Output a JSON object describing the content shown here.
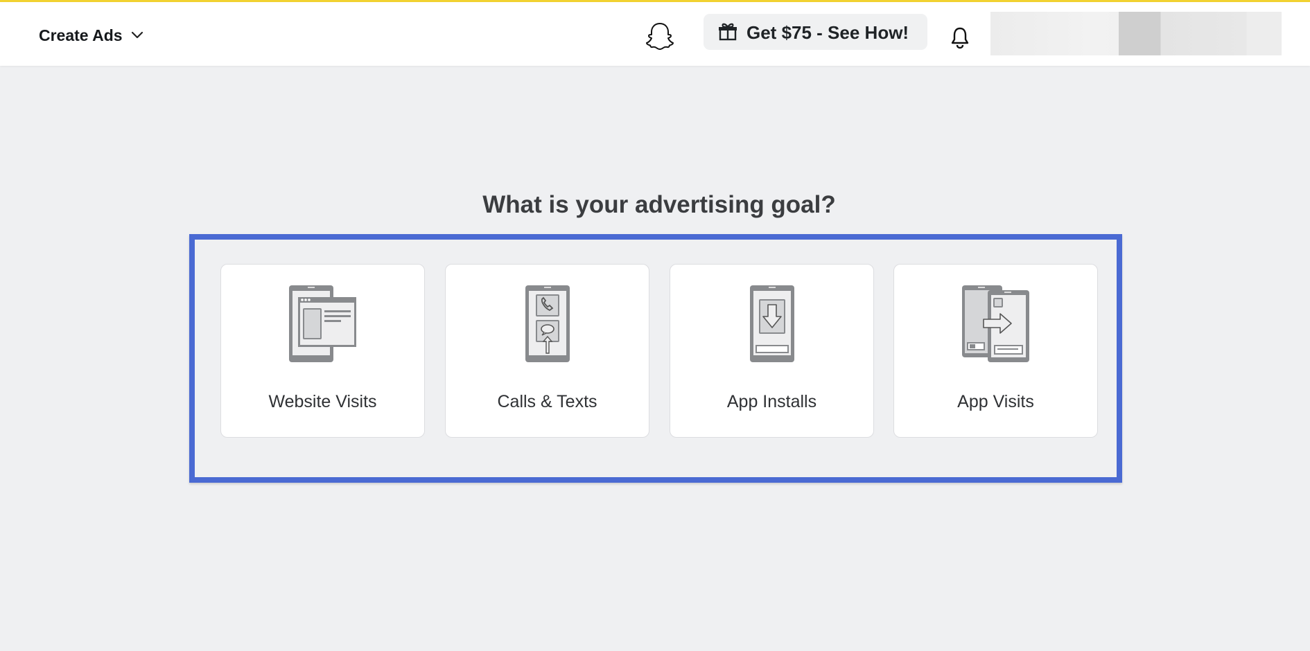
{
  "header": {
    "menu_label": "Create Ads",
    "promo_label": "Get $75 - See How!",
    "icons": [
      "chevron-down-icon",
      "snapchat-ghost-icon",
      "gift-icon",
      "bell-icon"
    ]
  },
  "main": {
    "heading": "What is your advertising goal?",
    "goals": [
      {
        "label": "Website Visits",
        "icon": "website-visits-icon"
      },
      {
        "label": "Calls & Texts",
        "icon": "calls-texts-icon"
      },
      {
        "label": "App Installs",
        "icon": "app-installs-icon"
      },
      {
        "label": "App Visits",
        "icon": "app-visits-icon"
      }
    ]
  },
  "colors": {
    "accent_top": "#f2d230",
    "highlight_border": "#4a6ad3",
    "background": "#eff0f2",
    "icon_gray": "#888a8d"
  }
}
